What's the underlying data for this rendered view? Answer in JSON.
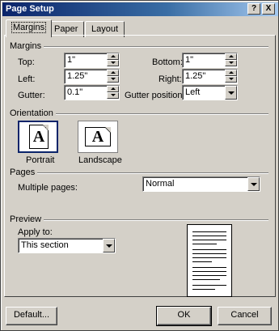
{
  "window": {
    "title": "Page Setup",
    "help_button": "?",
    "close_button": "X"
  },
  "tabs": [
    {
      "label": "Margins",
      "active": true
    },
    {
      "label": "Paper",
      "active": false
    },
    {
      "label": "Layout",
      "active": false
    }
  ],
  "margins": {
    "section_label": "Margins",
    "top_label": "Top:",
    "top_value": "1\"",
    "bottom_label": "Bottom:",
    "bottom_value": "1\"",
    "left_label": "Left:",
    "left_value": "1.25\"",
    "right_label": "Right:",
    "right_value": "1.25\"",
    "gutter_label": "Gutter:",
    "gutter_value": "0.1\"",
    "gutter_position_label": "Gutter position:",
    "gutter_position_value": "Left"
  },
  "orientation": {
    "section_label": "Orientation",
    "portrait_label": "Portrait",
    "landscape_label": "Landscape",
    "portrait_glyph": "A",
    "landscape_glyph": "A",
    "selected": "Portrait"
  },
  "pages": {
    "section_label": "Pages",
    "multiple_pages_label": "Multiple pages:",
    "multiple_pages_value": "Normal"
  },
  "preview": {
    "section_label": "Preview",
    "apply_to_label": "Apply to:",
    "apply_to_value": "This section"
  },
  "buttons": {
    "default_label": "Default...",
    "ok_label": "OK",
    "cancel_label": "Cancel"
  },
  "colors": {
    "face": "#d4d0c8",
    "title_bar": "#0a246a",
    "selection": "#0a246a"
  }
}
